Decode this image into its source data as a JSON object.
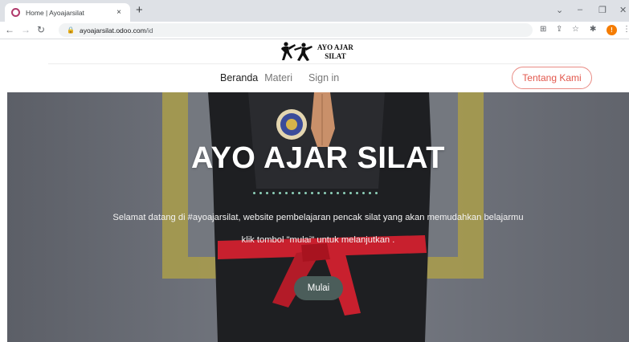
{
  "browser": {
    "tab_title": "Home | Ayoajarsilat",
    "tab_close": "×",
    "new_tab": "+",
    "url_host": "ayoajarsilat.odoo.com",
    "url_path": "/id",
    "profile_initial": "!",
    "controls": {
      "minimize": "–",
      "restore": "❐",
      "close": "✕",
      "chevron": "⌄"
    },
    "toolbar_icons": [
      "translate-icon",
      "share-icon",
      "star-icon",
      "extensions-icon"
    ]
  },
  "site": {
    "logo_text_line1": "AYO AJAR",
    "logo_text_line2": "SILAT",
    "menu": [
      {
        "label": "Beranda"
      },
      {
        "label": "Materi"
      },
      {
        "label": "Sign in"
      }
    ],
    "about_button": "Tentang Kami",
    "brand_color": "#e2574c"
  },
  "hero": {
    "title": "AYO AJAR SILAT",
    "subtitle_1": "Selamat datang di #ayoajarsilat, website pembelajaran pencak silat yang akan memudahkan belajarmu",
    "subtitle_2": "klik tombol \"mulai\" untuk melanjutkan .",
    "start_button": "Mulai",
    "dots_count": 20,
    "dot_color": "#8ed0b9",
    "bg_color": "#6f737c",
    "frame_color": "#a69a4e",
    "belt_color": "#c8202e"
  }
}
